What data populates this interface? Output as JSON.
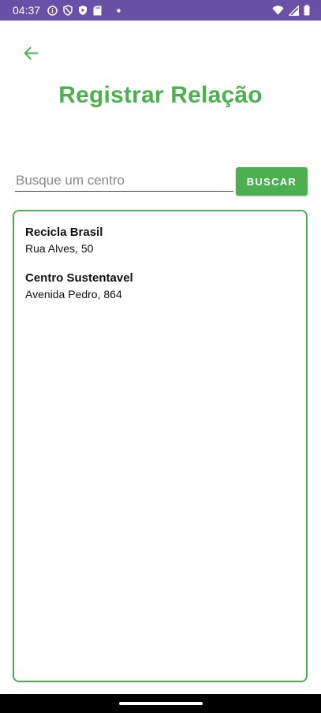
{
  "status_bar": {
    "time": "04:37",
    "left_icons": [
      "info-circle-icon",
      "shield-outline-icon",
      "shield-play-icon",
      "sd-card-icon",
      "dot-icon"
    ],
    "right_icons": [
      "wifi-icon",
      "signal-icon",
      "battery-icon"
    ],
    "background": "#6a4fa6"
  },
  "header": {
    "back_icon": "arrow-left-icon",
    "title": "Registrar Relação"
  },
  "search": {
    "placeholder": "Busque um centro",
    "value": "",
    "button_label": "BUSCAR"
  },
  "results": [
    {
      "name": "Recicla Brasil",
      "address": "Rua Alves, 50"
    },
    {
      "name": "Centro Sustentavel",
      "address": "Avenida Pedro, 864"
    }
  ],
  "colors": {
    "accent": "#4caf50",
    "status_bar": "#6a4fa6",
    "text": "#111111"
  }
}
